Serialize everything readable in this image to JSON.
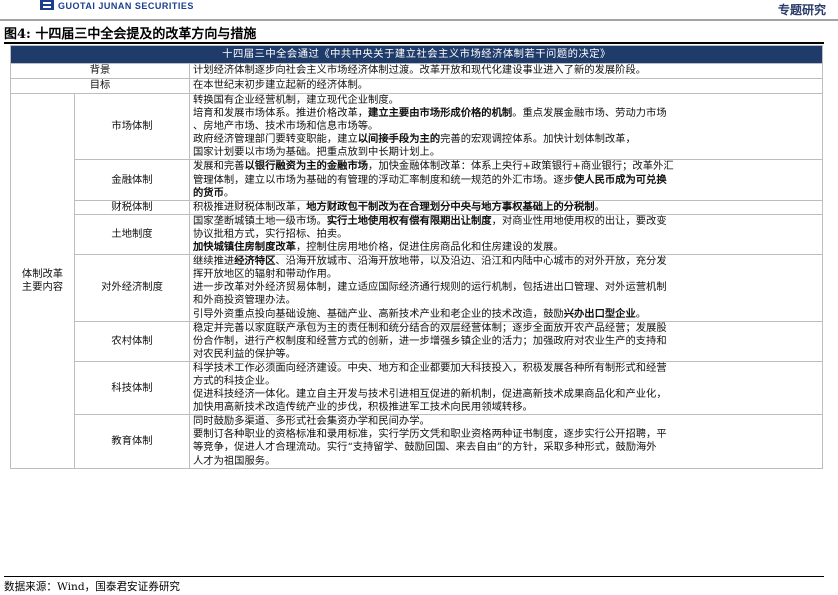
{
  "header": {
    "brand": "GUOTAI JUNAN SECURITIES",
    "report_type": "专题研究"
  },
  "figure": {
    "title": "图4:  十四届三中全会提及的改革方向与措施",
    "table_title": "十四届三中全会通过《中共中央关于建立社会主义市场经济体制若干问题的决定》"
  },
  "rows": {
    "background": {
      "label": "背景",
      "lines": [
        [
          "计划经济体制逐步向社会主义市场经济体制过渡。改革开放和现代化建设事业进入了新的发展阶段。"
        ]
      ]
    },
    "goal": {
      "label": "目标",
      "lines": [
        [
          "在本世纪末初步建立起新的经济体制。"
        ]
      ]
    }
  },
  "reform": {
    "group_label_line1": "体制改革",
    "group_label_line2": "主要内容",
    "items": [
      {
        "label": "市场体制",
        "lines": [
          [
            "转换国有企业经营机制，建立现代企业制度。"
          ],
          [
            "培育和发展市场体系。推进价格改革，",
            "B:建立主要由市场形成价格的机制",
            "。重点发展金融市场、劳动力市场"
          ],
          [
            "、房地产市场、技术市场和信息市场等。"
          ],
          [
            "政府经济管理部门要转变职能，建立",
            "B:以间接手段为主的",
            "完善的宏观调控体系。加快计划体制改革，"
          ],
          [
            "国家计划要以市场为基础。把重点放到中长期计划上。"
          ]
        ]
      },
      {
        "label": "金融体制",
        "lines": [
          [
            "发展和完善",
            "B:以银行融资为主的金融市场",
            "，加快金融体制改革：体系上央行+政策银行+商业银行；改革外汇"
          ],
          [
            "管理体制，建立以市场为基础的有管理的浮动汇率制度和统一规范的外汇市场。逐步",
            "B:使人民币成为可兑换"
          ],
          [
            "B:的货币",
            "。"
          ]
        ]
      },
      {
        "label": "财税体制",
        "lines": [
          [
            "积极推进财税体制改革，",
            "B:地方财政包干制改为在合理划分中央与地方事权基础上的分税制",
            "。"
          ]
        ]
      },
      {
        "label": "土地制度",
        "lines": [
          [
            "国家垄断城镇土地一级市场。",
            "B:实行土地使用权有偿有限期出让制度",
            "，对商业性用地使用权的出让，要改变"
          ],
          [
            "协议批租方式，实行招标、拍卖。"
          ],
          [
            "B:加快城镇住房制度改革",
            "，控制住房用地价格，促进住房商品化和住房建设的发展。"
          ]
        ]
      },
      {
        "label": "对外经济制度",
        "lines": [
          [
            "继续推进",
            "B:经济特区",
            "、沿海开放城市、沿海开放地带，以及沿边、沿江和内陆中心城市的对外开放，充分发"
          ],
          [
            "挥开放地区的辐射和带动作用。"
          ],
          [
            "进一步改革对外经济贸易体制，建立适应国际经济通行规则的运行机制，包括进出口管理、对外运营机制"
          ],
          [
            "和外商投资管理办法。"
          ],
          [
            "引导外资重点投向基础设施、基础产业、高新技术产业和老企业的技术改造，鼓励",
            "B:兴办出口型企业",
            "。"
          ]
        ]
      },
      {
        "label": "农村体制",
        "lines": [
          [
            "稳定并完善以家庭联产承包为主的责任制和统分结合的双层经营体制；逐步全面放开农产品经营；发展股"
          ],
          [
            "份合作制，进行产权制度和经营方式的创新，进一步增强乡镇企业的活力；加强政府对农业生产的支持和"
          ],
          [
            "对农民利益的保护等。"
          ]
        ]
      },
      {
        "label": "科技体制",
        "lines": [
          [
            "科学技术工作必须面向经济建设。中央、地方和企业都要加大科技投入，积极发展各种所有制形式和经营"
          ],
          [
            "方式的科技企业。"
          ],
          [
            "促进科技经济一体化。建立自主开发与技术引进相互促进的新机制，促进高新技术成果商品化和产业化，"
          ],
          [
            "加快用高新技术改造传统产业的步伐，积极推进军工技术向民用领域转移。"
          ]
        ]
      },
      {
        "label": "教育体制",
        "lines": [
          [
            "同时鼓励多渠道、多形式社会集资办学和民间办学。"
          ],
          [
            "要制订各种职业的资格标准和录用标准，实行学历文凭和职业资格两种证书制度，逐步实行公开招聘，平"
          ],
          [
            "等竞争，促进人才合理流动。实行“支持留学、鼓励回国、来去自由”的方针，采取多种形式，鼓励海外"
          ],
          [
            "人才为祖国服务。"
          ]
        ]
      }
    ]
  },
  "footer": {
    "source": "数据来源：Wind，国泰君安证券研究"
  },
  "colors": {
    "title_bar": "#1f3b6a",
    "brand": "#1a3f8f",
    "border": "#bdbdbd"
  }
}
